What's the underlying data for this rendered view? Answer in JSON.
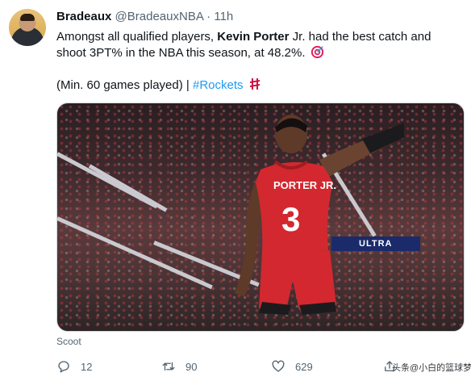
{
  "tweet": {
    "display_name": "Bradeaux",
    "handle": "@BradeauxNBA",
    "separator": "·",
    "time": "11h",
    "text_pre": "Amongst all qualified players, ",
    "text_bold": "Kevin Porter",
    "text_post": " Jr. had the best catch and shoot 3PT% in the NBA this season, at 48.2%.",
    "qualifier": "(Min. 60 games played) | ",
    "hashtag": "#Rockets",
    "media": {
      "jersey_name": "PORTER JR.",
      "jersey_number": "3",
      "banner_text": "ULTRA"
    },
    "media_caption": "Scoot",
    "replies": "12",
    "retweets": "90",
    "likes": "629",
    "watermark": "头条@小白的篮球梦"
  },
  "icons": {
    "target": "target-icon",
    "rockets": "rockets-logo-icon",
    "reply": "reply-icon",
    "retweet": "retweet-icon",
    "like": "heart-icon",
    "share": "share-icon"
  },
  "colors": {
    "link": "#1d9bf0",
    "secondary_text": "#536471",
    "jersey_red": "#d3282f"
  }
}
